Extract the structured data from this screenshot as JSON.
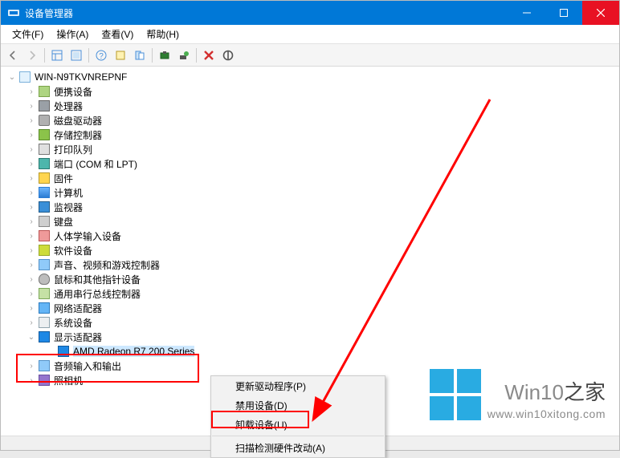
{
  "window": {
    "title": "设备管理器"
  },
  "menubar": {
    "file": "文件(F)",
    "action": "操作(A)",
    "view": "查看(V)",
    "help": "帮助(H)"
  },
  "tree": {
    "root": "WIN-N9TKVNREPNF",
    "items": [
      {
        "label": "便携设备",
        "icon": "ic-portable"
      },
      {
        "label": "处理器",
        "icon": "ic-chip"
      },
      {
        "label": "磁盘驱动器",
        "icon": "ic-disk"
      },
      {
        "label": "存储控制器",
        "icon": "ic-usb"
      },
      {
        "label": "打印队列",
        "icon": "ic-printer"
      },
      {
        "label": "端口 (COM 和 LPT)",
        "icon": "ic-port"
      },
      {
        "label": "固件",
        "icon": "ic-firmware"
      },
      {
        "label": "计算机",
        "icon": "ic-computer"
      },
      {
        "label": "监视器",
        "icon": "ic-monitor"
      },
      {
        "label": "键盘",
        "icon": "ic-keyboard"
      },
      {
        "label": "人体学输入设备",
        "icon": "ic-hid"
      },
      {
        "label": "软件设备",
        "icon": "ic-software"
      },
      {
        "label": "声音、视频和游戏控制器",
        "icon": "ic-sound"
      },
      {
        "label": "鼠标和其他指针设备",
        "icon": "ic-mouse"
      },
      {
        "label": "通用串行总线控制器",
        "icon": "ic-serial"
      },
      {
        "label": "网络适配器",
        "icon": "ic-net"
      },
      {
        "label": "系统设备",
        "icon": "ic-system"
      }
    ],
    "display_adapters": {
      "label": "显示适配器",
      "child": "AMD Radeon R7 200 Series"
    },
    "after": [
      {
        "label": "音频输入和输出",
        "icon": "ic-sound"
      },
      {
        "label": "照相机",
        "icon": "ic-camera"
      }
    ]
  },
  "context_menu": {
    "update": "更新驱动程序(P)",
    "disable": "禁用设备(D)",
    "uninstall": "卸载设备(U)",
    "scan": "扫描检测硬件改动(A)"
  },
  "watermark": {
    "brand_main": "Win10",
    "brand_suffix": "之家",
    "url": "www.win10xitong.com"
  }
}
